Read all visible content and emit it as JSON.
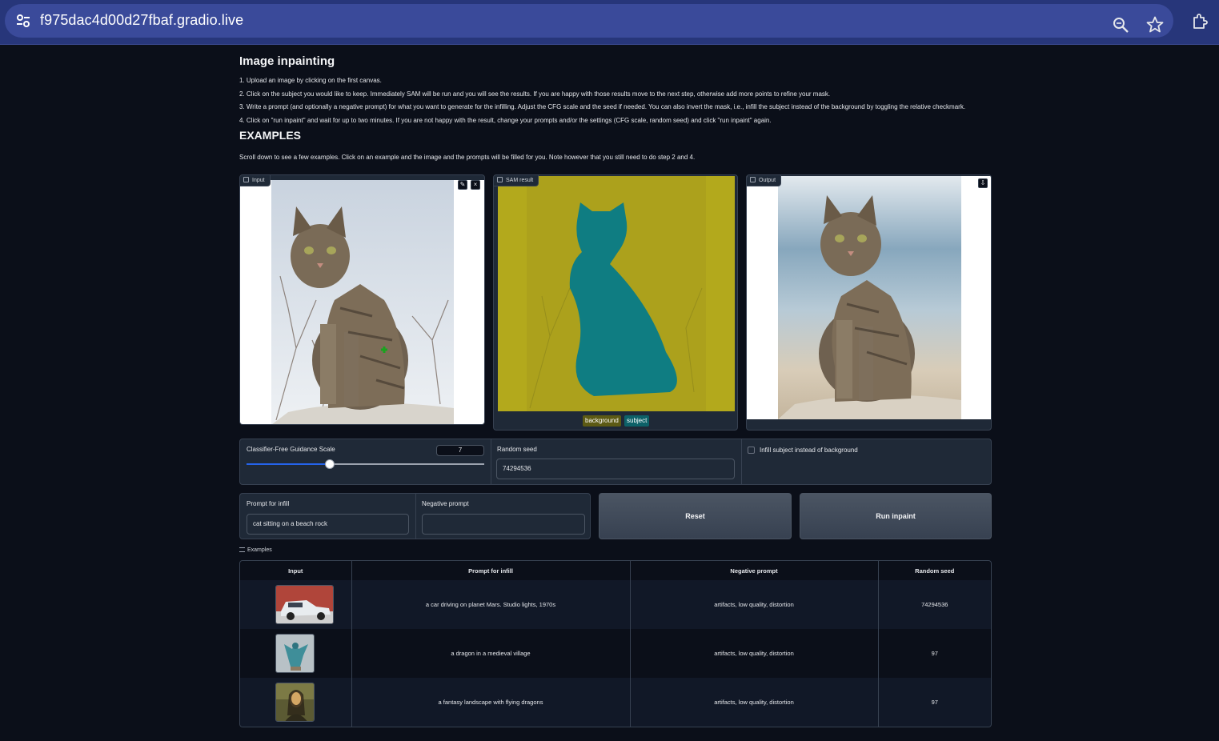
{
  "browser": {
    "url": "f975dac4d00d27fbaf.gradio.live",
    "icons": [
      "tune-icon",
      "zoom-icon",
      "star-icon",
      "extensions-icon"
    ]
  },
  "header": {
    "title": "Image inpainting",
    "steps": [
      "1. Upload an image by clicking on the first canvas.",
      "2. Click on the subject you would like to keep. Immediately SAM will be run and you will see the results. If you are happy with those results move to the next step, otherwise add more points to refine your mask.",
      "3. Write a prompt (and optionally a negative prompt) for what you want to generate for the infilling. Adjust the CFG scale and the seed if needed. You can also invert the mask, i.e., infill the subject instead of the background by toggling the relative checkmark.",
      "4. Click on \"run inpaint\" and wait for up to two minutes. If you are not happy with the result, change your prompts and/or the settings (CFG scale, random seed) and click \"run inpaint\" again."
    ],
    "examples_title": "EXAMPLES",
    "examples_note": "Scroll down to see a few examples. Click on an example and the image and the prompts will be filled for you. Note however that you still need to do step 2 and 4."
  },
  "panels": {
    "input_label": "Input",
    "sam_label": "SAM result",
    "output_label": "Output",
    "legend": {
      "background": "background",
      "subject": "subject"
    },
    "colors": {
      "background": "#b3a91c",
      "subject": "#0f7d82",
      "tag_bg": "#5c5a14",
      "tag_subject": "#0d6168"
    }
  },
  "controls": {
    "cfg_label": "Classifier-Free Guidance Scale",
    "cfg_value": "7",
    "cfg_fraction": 0.35,
    "seed_label": "Random seed",
    "seed_value": "74294536",
    "invert_label": "Infill subject instead of background",
    "invert_checked": false,
    "prompt_label": "Prompt for infill",
    "prompt_value": "cat sitting on a beach rock",
    "neg_label": "Negative prompt",
    "neg_value": "",
    "reset_label": "Reset",
    "run_label": "Run inpaint"
  },
  "examples": {
    "label": "Examples",
    "headers": [
      "Input",
      "Prompt for infill",
      "Negative prompt",
      "Random seed"
    ],
    "rows": [
      {
        "thumb": "car-thumbnail",
        "prompt": "a car driving on planet Mars. Studio lights, 1970s",
        "negative": "artifacts, low quality, distortion",
        "seed": "74294536"
      },
      {
        "thumb": "dragon-thumbnail",
        "prompt": "a dragon in a medieval village",
        "negative": "artifacts, low quality, distortion",
        "seed": "97"
      },
      {
        "thumb": "mona-lisa-thumbnail",
        "prompt": "a fantasy landscape with flying dragons",
        "negative": "artifacts, low quality, distortion",
        "seed": "97"
      }
    ]
  }
}
